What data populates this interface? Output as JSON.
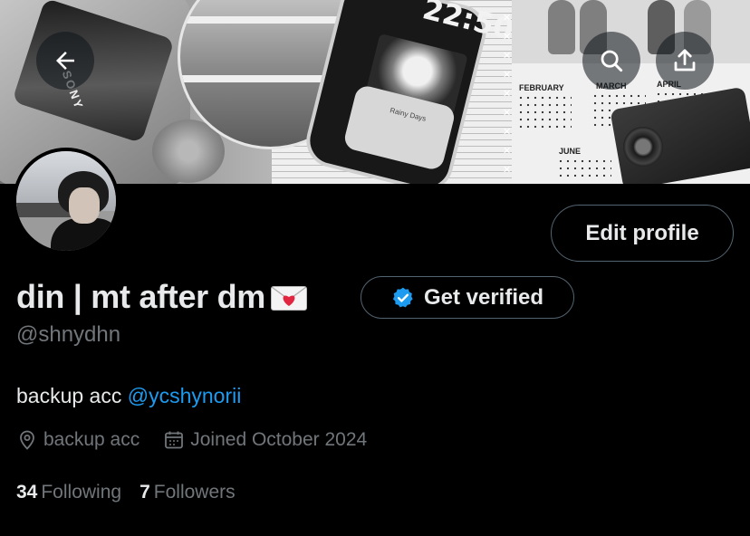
{
  "banner": {
    "device_brand": "SONY",
    "phone_time": "22:50",
    "phone_song": "Rainy Days",
    "calendar_months": [
      "FEBRUARY",
      "MARCH",
      "APRIL",
      "JUNE"
    ]
  },
  "header": {
    "back_icon": "arrow-left-icon",
    "search_icon": "search-icon",
    "share_icon": "share-upload-icon"
  },
  "profile": {
    "display_name": "din | mt after dm",
    "name_emoji": "envelope-heart-icon",
    "handle": "@shnydhn",
    "edit_label": "Edit profile",
    "verify_label": "Get verified",
    "bio_text": "backup acc ",
    "bio_mention": "@ycshynorii",
    "location": "backup acc",
    "joined": "Joined October 2024",
    "following_count": "34",
    "following_label": "Following",
    "followers_count": "7",
    "followers_label": "Followers"
  },
  "colors": {
    "background": "#000000",
    "text_primary": "#e7e9ea",
    "text_secondary": "#71767b",
    "link": "#1d9bf0",
    "border": "#536471",
    "verified_badge": "#1d9bf0"
  }
}
